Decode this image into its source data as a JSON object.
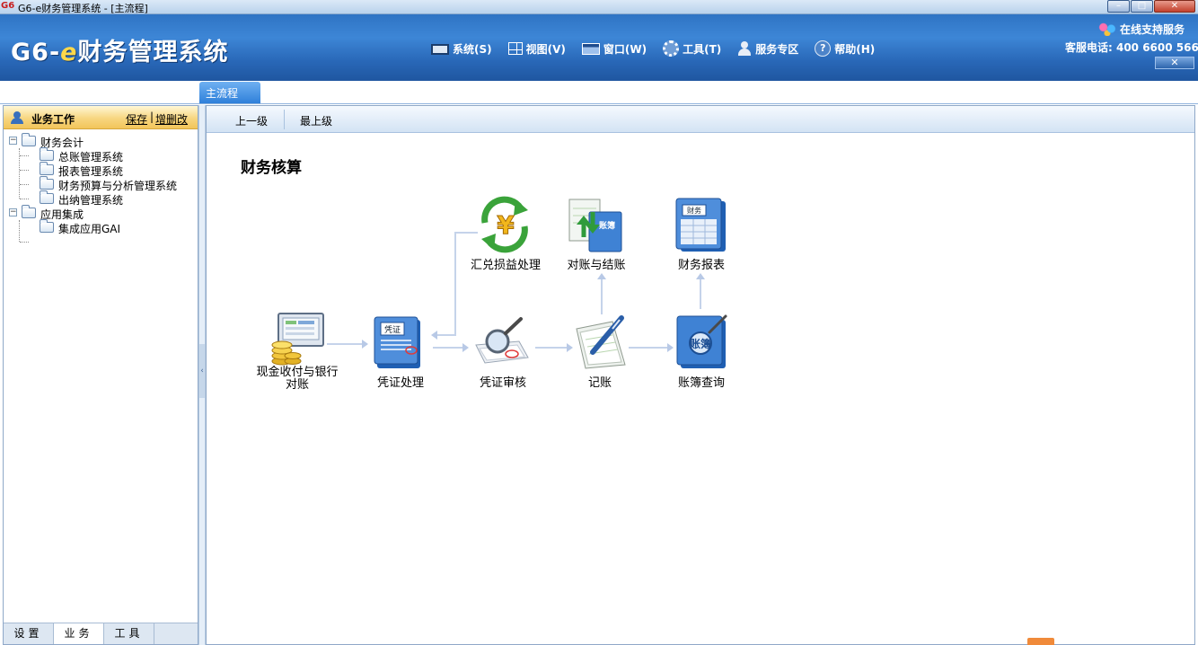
{
  "window": {
    "app_icon_text": "G6",
    "title": "G6-e财务管理系统 - [主流程]",
    "min_glyph": "–",
    "max_glyph": "□",
    "close_glyph": "✕"
  },
  "header": {
    "logo_prefix": "G6-",
    "logo_e": "e",
    "logo_suffix": "财务管理系统",
    "menu": [
      {
        "label": "系统(S)",
        "icon": "monitor-icon"
      },
      {
        "label": "视图(V)",
        "icon": "grid-icon"
      },
      {
        "label": "窗口(W)",
        "icon": "window-icon"
      },
      {
        "label": "工具(T)",
        "icon": "gear-icon"
      },
      {
        "label": "服务专区",
        "icon": "person-icon"
      },
      {
        "label": "帮助(H)",
        "icon": "help-icon"
      }
    ],
    "support_label": "在线支持服务",
    "phone_label": "客服电话:  400 6600 566",
    "close_glyph": "✕"
  },
  "tabs": {
    "main_tab": "主流程"
  },
  "left_panel": {
    "title": "业务工作",
    "save_link": "保存",
    "separator": "|",
    "edit_link": "增删改",
    "tree": [
      {
        "label": "财务会计",
        "level": 0,
        "expanded": true
      },
      {
        "label": "总账管理系统",
        "level": 1
      },
      {
        "label": "报表管理系统",
        "level": 1
      },
      {
        "label": "财务预算与分析管理系统",
        "level": 1
      },
      {
        "label": "出纳管理系统",
        "level": 1
      },
      {
        "label": "应用集成",
        "level": 0,
        "expanded": true
      },
      {
        "label": "集成应用GAI",
        "level": 1
      }
    ],
    "expander_glyph": "−",
    "bottom_tabs": [
      "设置",
      "业务",
      "工具"
    ],
    "active_tab": "业务"
  },
  "content": {
    "nav_up": "上一级",
    "nav_top": "最上级",
    "section_title": "财务核算",
    "flow": {
      "cash": "现金收付与银行\n对账",
      "voucher": "凭证处理",
      "audit": "凭证审核",
      "post": "记账",
      "query": "账簿查询",
      "exchange": "汇兑损益处理",
      "reconcile": "对账与结账",
      "report": "财务报表"
    },
    "icon_texts": {
      "voucher": "凭证",
      "reconcile": "账簿",
      "report": "财务",
      "query": "账簿",
      "exchange": "¥"
    }
  },
  "colors": {
    "header_blue": "#2f74c4",
    "tab_blue": "#2f80da",
    "panel_header_gold": "#f2c55a",
    "arrow": "#c5d3ea"
  }
}
